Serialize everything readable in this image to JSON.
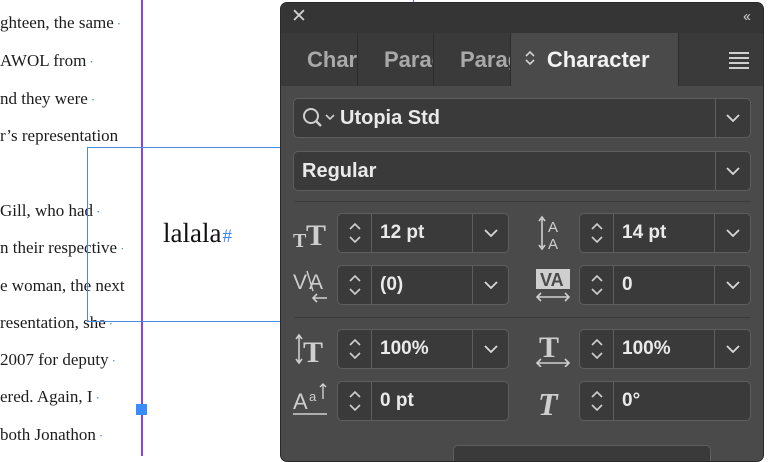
{
  "document": {
    "lines": [
      "ghteen, the same",
      "AWOL from",
      "nd they were",
      "r’s representation",
      "",
      "Gill, who had",
      "n their respective",
      "e woman, the next",
      "resentation, she",
      "2007 for deputy",
      "ered. Again, I",
      "both Jonathon"
    ],
    "frame_text": "lalala",
    "frame_text_end": "#"
  },
  "panel": {
    "close_glyph": "✕",
    "collapse_glyph": "‹‹",
    "tabs": [
      {
        "label": "Char",
        "active": false
      },
      {
        "label": "Parag",
        "active": false
      },
      {
        "label": "Parag",
        "active": false
      },
      {
        "label": "Character",
        "active": true
      }
    ],
    "active_tab_icon": "sort-arrows-icon",
    "font_family": {
      "value": "Utopia Std",
      "icon": "search-icon"
    },
    "font_style": {
      "value": "Regular"
    },
    "size": {
      "value": "12 pt",
      "icon": "font-size-icon"
    },
    "leading": {
      "value": "14 pt",
      "icon": "leading-icon"
    },
    "kerning": {
      "value": "(0)",
      "icon": "kerning-icon"
    },
    "tracking": {
      "value": "0",
      "icon": "tracking-icon"
    },
    "vertical_scale": {
      "value": "100%",
      "icon": "vertical-scale-icon"
    },
    "horizontal_scale": {
      "value": "100%",
      "icon": "horizontal-scale-icon"
    },
    "baseline_shift": {
      "value": "0 pt",
      "icon": "baseline-shift-icon"
    },
    "skew": {
      "value": "0°",
      "icon": "skew-icon"
    }
  },
  "colors": {
    "panel_bg": "#4a4a4a",
    "field_bg": "#3a3a3a",
    "text": "#eaeaea",
    "margin_guide": "#8a3ff0",
    "frame_border": "#4a8ae6"
  }
}
